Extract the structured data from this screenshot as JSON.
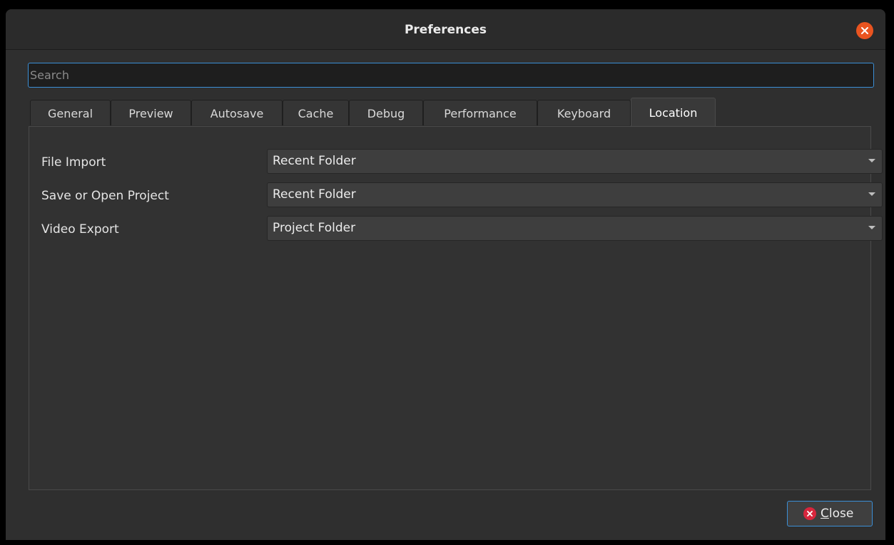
{
  "window": {
    "title": "Preferences"
  },
  "search": {
    "placeholder": "Search",
    "value": ""
  },
  "tabs": [
    {
      "label": "General"
    },
    {
      "label": "Preview"
    },
    {
      "label": "Autosave"
    },
    {
      "label": "Cache"
    },
    {
      "label": "Debug"
    },
    {
      "label": "Performance"
    },
    {
      "label": "Keyboard"
    },
    {
      "label": "Location",
      "active": true
    }
  ],
  "settings": [
    {
      "label": "File Import",
      "value": "Recent Folder"
    },
    {
      "label": "Save or Open Project",
      "value": "Recent Folder"
    },
    {
      "label": "Video Export",
      "value": "Project Folder"
    }
  ],
  "footer": {
    "close_mnemonic": "C",
    "close_rest": "lose"
  },
  "colors": {
    "accent": "#3b8fd6",
    "titlebar_close": "#e95420",
    "close_icon": "#d7263d"
  },
  "icons": {
    "titlebar_close": "close-icon",
    "dropdown": "chevron-down-icon",
    "button_close": "close-circle-icon"
  }
}
